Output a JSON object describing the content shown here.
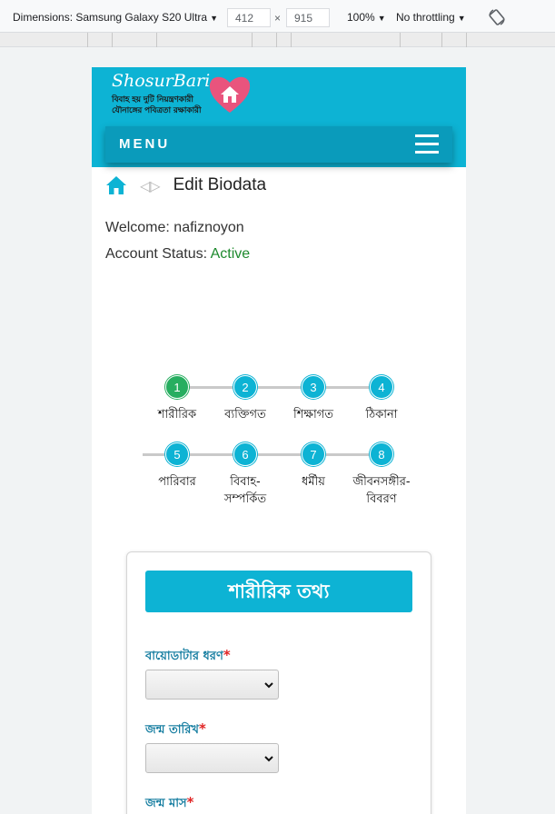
{
  "devtools": {
    "dimensions_label": "Dimensions: Samsung Galaxy S20 Ultra",
    "width_value": "412",
    "height_value": "915",
    "times": "×",
    "zoom": "100%",
    "throttling": "No throttling",
    "caret": "▼"
  },
  "header": {
    "logo_text": "ShosurBari",
    "tagline_line1": "বিবাহ হয় দুটি নিয়ন্ত্রণকারী",
    "tagline_line2": "যৌনাঙ্গের পবিত্রতা রক্ষাকারী",
    "menu_label": "MENU"
  },
  "breadcrumb": {
    "separator": "◁▷",
    "title": "Edit Biodata"
  },
  "account": {
    "welcome_label": "Welcome:",
    "username": "nafiznoyon",
    "status_label": "Account Status:",
    "status_value": "Active"
  },
  "steps": [
    {
      "num": "1",
      "label": "শারীরিক",
      "label2": ""
    },
    {
      "num": "2",
      "label": "ব্যক্তিগত",
      "label2": ""
    },
    {
      "num": "3",
      "label": "শিক্ষাগত",
      "label2": ""
    },
    {
      "num": "4",
      "label": "ঠিকানা",
      "label2": ""
    },
    {
      "num": "5",
      "label": "পারিবার",
      "label2": ""
    },
    {
      "num": "6",
      "label": "বিবাহ-",
      "label2": "সম্পর্কিত"
    },
    {
      "num": "7",
      "label": "ধর্মীয়",
      "label2": ""
    },
    {
      "num": "8",
      "label": "জীবনসঙ্গীর-",
      "label2": "বিবরণ"
    }
  ],
  "form": {
    "title": "শারীরিক তথ্য",
    "required_mark": "*",
    "fields": [
      {
        "label": "বায়োডাটার ধরণ",
        "value": ""
      },
      {
        "label": "জন্ম তারিখ",
        "value": ""
      },
      {
        "label": "জন্ম মাস",
        "value": ""
      }
    ]
  },
  "colors": {
    "brand": "#0db3d4",
    "menu_bar": "#0a9bbb",
    "step_done": "#27ae60",
    "active_status": "#1e8a2e",
    "required": "#e02424"
  },
  "icons": [
    "home-icon",
    "rotate-icon",
    "hamburger-icon",
    "heart-logo-icon",
    "chevron-down-icon"
  ]
}
